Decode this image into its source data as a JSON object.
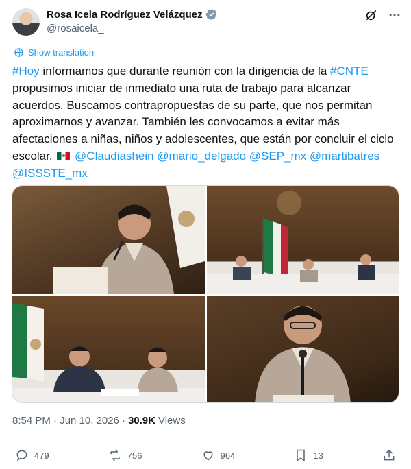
{
  "author": {
    "name": "Rosa Icela Rodríguez Velázquez",
    "handle": "@rosaicela_"
  },
  "translate_label": "Show translation",
  "text": {
    "seg1": "#Hoy",
    "seg2": " informamos que durante reunión con la dirigencia de la ",
    "seg3": "#CNTE",
    "seg4": " propusimos iniciar de inmediato una ruta de trabajo para alcanzar acuerdos. Buscamos contrapropuestas de su parte, que nos permitan aproximarnos y avanzar. También les convocamos a evitar más afectaciones a niñas, niños y adolescentes, que están por concluir el ciclo escolar. ",
    "m1": "@Claudiashein",
    "m2": "@mario_delgado",
    "m3": "@SEP_mx",
    "m4": "@martibatres",
    "m5": "@ISSSTE_mx"
  },
  "timestamp": "8:54 PM · Jun 10, 2026",
  "views_count": "30.9K",
  "views_label": "Views",
  "actions": {
    "replies": "479",
    "reposts": "756",
    "likes": "964",
    "bookmarks": "13"
  },
  "colors": {
    "accent": "#1d9bf0",
    "muted": "#536471",
    "text": "#0f1419"
  }
}
